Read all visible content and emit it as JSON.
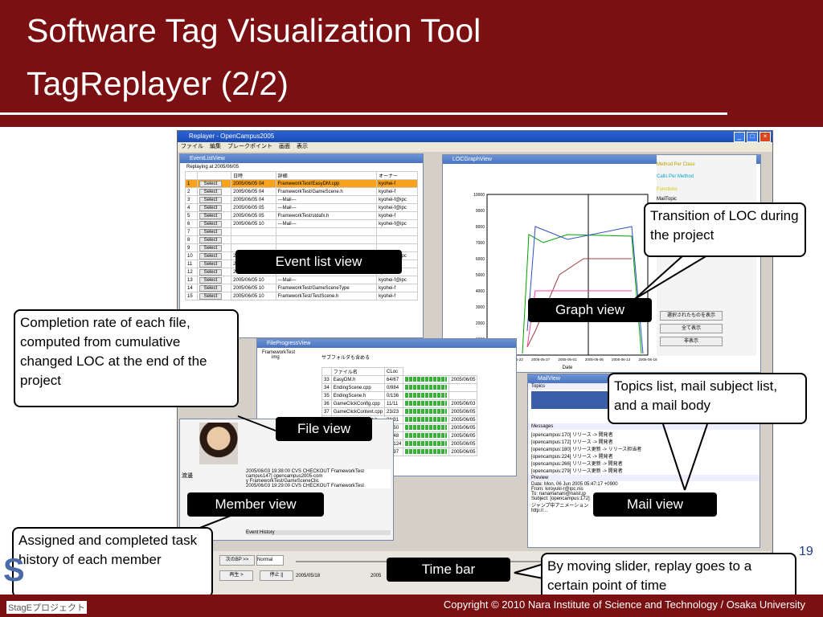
{
  "slide": {
    "title_line1": "Software Tag Visualization Tool",
    "title_line2": "TagReplayer (2/2)",
    "slide_number": "19",
    "copyright": "Copyright © 2010 Nara Institute of Science and Technology / Osaka University",
    "logo_text": "S",
    "logo_sub": "StagEプロジェクト"
  },
  "app": {
    "window_title": "Replayer - OpenCampus2005",
    "menu": [
      "ファイル",
      "編集",
      "ブレークポイント",
      "画面",
      "表示"
    ],
    "event_window_title": "EventListView",
    "replaying_text": "Replaying at 2005/06/05",
    "event_headers": [
      "",
      "",
      "日時",
      "詳細",
      "オーナー"
    ],
    "select_label": "Select",
    "events": [
      {
        "no": "1",
        "date": "2005/06/05 04",
        "detail": "FrameworkTest/EasyDM.cpp",
        "owner": "kyohei-f"
      },
      {
        "no": "2",
        "date": "2005/06/05 04",
        "detail": "FrameworkTest/GameScene.h",
        "owner": "kyohei-f"
      },
      {
        "no": "3",
        "date": "2005/06/05 04",
        "detail": "---Mail---",
        "owner": "kyohei-f@ipc"
      },
      {
        "no": "4",
        "date": "2005/06/05 05",
        "detail": "---Mail---",
        "owner": "kyohei-f@ipc"
      },
      {
        "no": "5",
        "date": "2005/06/05 05",
        "detail": "FrameworkTest/stdafx.h",
        "owner": "kyohei-f"
      },
      {
        "no": "6",
        "date": "2005/06/05 10",
        "detail": "---Mail---",
        "owner": "kyohei-f@ipc"
      },
      {
        "no": "7",
        "date": "",
        "detail": "",
        "owner": ""
      },
      {
        "no": "8",
        "date": "",
        "detail": "",
        "owner": ""
      },
      {
        "no": "9",
        "date": "",
        "detail": "",
        "owner": ""
      },
      {
        "no": "10",
        "date": "2005/06/05 10",
        "detail": "---Mail---",
        "owner": "kyohei-f@ipc"
      },
      {
        "no": "11",
        "date": "2005/06/05 10",
        "detail": "FrameworkTest/MouseListener.cpp",
        "owner": "kyohei-f"
      },
      {
        "no": "12",
        "date": "2005/06/05 10",
        "detail": "FrameworkTest/GameView.h",
        "owner": "kyohei-f"
      },
      {
        "no": "13",
        "date": "2005/06/05 10",
        "detail": "---Mail---",
        "owner": "kyohei-f@ipc"
      },
      {
        "no": "14",
        "date": "2005/06/05 10",
        "detail": "FrameworkTest/GameSceneType",
        "owner": "kyohei-f"
      },
      {
        "no": "15",
        "date": "2005/06/05 10",
        "detail": "FrameworkTest/TestScene.h",
        "owner": "kyohei-f"
      }
    ],
    "graph_window_title": "LOCGraphView",
    "graph_xlabel": "Date",
    "graph_dates": [
      "2005-05-17",
      "2005-05-22",
      "2005-05-27",
      "2005-06-01",
      "2005-06-06",
      "2005-06-13",
      "2005-06-18"
    ],
    "graph_yticks": [
      "0",
      "1000",
      "2000",
      "3000",
      "4000",
      "5000",
      "6000",
      "7000",
      "8000",
      "9000",
      "10000"
    ],
    "file_window_title": "FileProgressView",
    "file_tree": [
      "FrameworkTest",
      "img"
    ],
    "file_option": "サブフォルダも含める",
    "file_headers": [
      "",
      "ファイル名",
      "CLoc"
    ],
    "files": [
      {
        "no": "33",
        "name": "EasyDM.h",
        "cloc": "64/67",
        "date": "2005/06/05"
      },
      {
        "no": "34",
        "name": "EndingScene.cpp",
        "cloc": "0/884",
        "date": ""
      },
      {
        "no": "35",
        "name": "EndingScene.h",
        "cloc": "0/136",
        "date": ""
      },
      {
        "no": "36",
        "name": "GameClickConfig.cpp",
        "cloc": "11/11",
        "date": "2005/06/03"
      },
      {
        "no": "37",
        "name": "GameClickContext.cpp",
        "cloc": "23/23",
        "date": "2005/06/05"
      },
      {
        "no": "38",
        "name": "GameClickContext.h",
        "cloc": "31/31",
        "date": "2005/06/05"
      },
      {
        "no": "39",
        "name": "GameController.cpp",
        "cloc": "50/50",
        "date": "2005/06/05"
      },
      {
        "no": "40",
        "name": "GameController.h",
        "cloc": "48/48",
        "date": "2005/06/05"
      },
      {
        "no": "41",
        "name": "GameScene.cpp",
        "cloc": "98/124",
        "date": "2005/06/05"
      },
      {
        "no": "42",
        "name": "GameScene.h",
        "cloc": "92/97",
        "date": "2005/06/05"
      }
    ],
    "right_panel": {
      "items": [
        "Method Per Class",
        "Calls Per Method",
        "Functions"
      ],
      "mail_topic": "MailTopic",
      "btn1": "選択されたものを表示",
      "btn2": "全て表示",
      "btn3": "非表示"
    },
    "mail_window_title": "MailView",
    "mail_topics_label": "Topics",
    "mail_messages_label": "Messages",
    "mail_messages": [
      "[opencampus:170] リリース -> 開発者",
      "[opencampus:172] リリース -> 開発者",
      "[opencampus:180] リリース更新 -> リリース担当者",
      "[opencampus:224] リリース -> 開発者",
      "[opencampus:266] リリース更新 -> 開発者",
      "[opencampus:279] リリース更新 -> 開発者"
    ],
    "mail_preview_label": "Preview",
    "mail_preview": [
      "Date: Mon, 06 Jun 2005 05:47:17 +0900",
      "From: kiroyuki-r@ipc.nis",
      "To: nanamanani@naist.jp",
      "Subject: [opencampus:172]",
      "ジャンプ中アニメーション",
      "http://..."
    ],
    "member_history": [
      "2005/06/03 19:38:00 CVS CHECKOUT FrameworkTest",
      "campus147] opencampus2005-com",
      "y FrameworkTest/GameSceneClic",
      "2005/06/03 19:29:00 CVS CHECKOUT FrameworkTest"
    ],
    "member_name": "渡邊",
    "event_history_label": "Event History",
    "time_controls": {
      "next_bp": "次のBP >>",
      "speed": "Normal",
      "play": "再生 >",
      "stop": "停止 ||",
      "date_left": "2005/05/18",
      "date_mid": "2005"
    }
  },
  "labels": {
    "event_list_view": "Event list view",
    "graph_view": "Graph view",
    "file_view": "File view",
    "member_view": "Member view",
    "mail_view": "Mail view",
    "time_bar": "Time bar"
  },
  "callouts": {
    "loc": "Transition of LOC during the project",
    "completion": "Completion rate of each file, computed from cumulative changed LOC at the end of the project",
    "topics": "Topics list, mail subject list, and a mail body",
    "assigned": "Assigned and completed task history of each member",
    "slider": "By moving slider, replay goes to a certain point of time"
  },
  "colors": {
    "header": "#7b1012",
    "label_bg": "#000000"
  }
}
